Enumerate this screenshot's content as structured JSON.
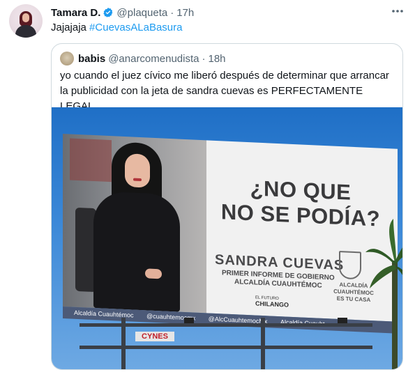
{
  "tweet": {
    "author_name": "Tamara D.",
    "handle": "@plaqueta",
    "separator": "·",
    "time": "17h",
    "text_prefix": "Jajajaja ",
    "hashtag": "#CuevasALaBasura"
  },
  "quoted_tweet": {
    "author_name": "babis",
    "handle": "@anarcomenudista",
    "separator": "·",
    "time": "18h",
    "text": "yo cuando el juez cívico me liberó después de determinar que arrancar la publicidad con la jeta de sandra cuevas es PERFECTAMENTE LEGAL"
  },
  "billboard": {
    "headline_line1": "¿NO QUE",
    "headline_line2": "NO SE PODÍA?",
    "name": "SANDRA CUEVAS",
    "subtitle_line1": "PRIMER INFORME DE GOBIERNO",
    "subtitle_line2": "ALCALDÍA CUAUHTÉMOC",
    "chilango_small": "EL FUTURO",
    "chilango": "CHILANGO",
    "crest_line1": "ALCALDÍA",
    "crest_line2": "CUAUHTÉMOC",
    "crest_line3": "ES TU CASA",
    "strip": [
      "Alcaldía Cuauhtémoc",
      "@cuauhtemocmx",
      "@AlcCuauhtemocMx",
      "Alcaldía Cuauht"
    ],
    "sponsor": "CYNES"
  },
  "icons": {
    "verified": "verified-badge-icon",
    "more": "more-options-icon"
  },
  "colors": {
    "link": "#1d9bf0",
    "secondary_text": "#536471",
    "border": "#cfd9de"
  }
}
